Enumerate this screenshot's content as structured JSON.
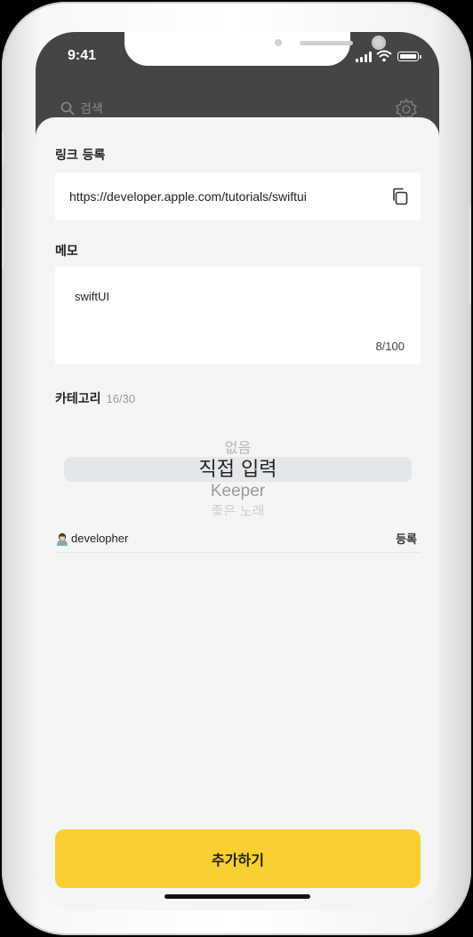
{
  "status_bar": {
    "time": "9:41"
  },
  "header": {
    "search_label": "검색"
  },
  "link_section": {
    "label": "링크 등록",
    "url": "https://developer.apple.com/tutorials/swiftui"
  },
  "memo_section": {
    "label": "메모",
    "text": "swiftUI",
    "count": "8/100"
  },
  "category_section": {
    "label": "카테고리",
    "count": "16/30",
    "picker_options": [
      "없음",
      "직접 입력",
      "Keeper",
      "좋은 노래"
    ],
    "selected": "직접 입력"
  },
  "developer_row": {
    "name": "developher",
    "register_label": "등록"
  },
  "add_button": {
    "label": "추가하기"
  },
  "colors": {
    "accent": "#f9cf32",
    "header_bg": "#454545",
    "sheet_bg": "#f3f5f6"
  },
  "icons": [
    "search-icon",
    "gear-icon",
    "copy-icon",
    "avatar-icon"
  ]
}
